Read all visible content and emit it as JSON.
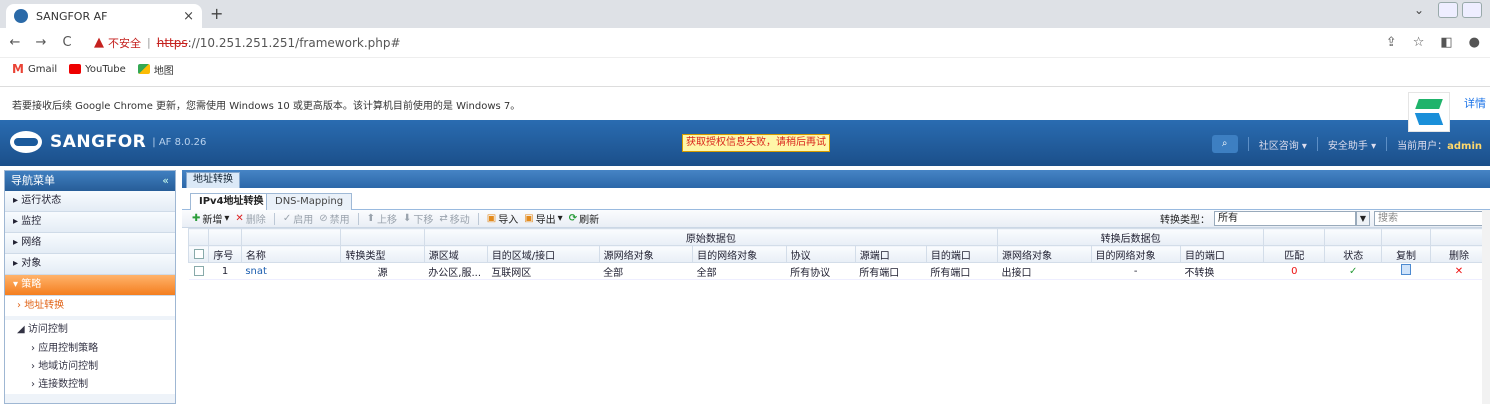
{
  "browser": {
    "tab_title": "SANGFOR AF",
    "tab_close": "×",
    "new_tab": "+",
    "insecure_label": "不安全",
    "url_scheme": "https",
    "url_rest": "://10.251.251.251/framework.php#",
    "bookmarks": [
      {
        "label": "Gmail",
        "icon": "gmail-icon"
      },
      {
        "label": "YouTube",
        "icon": "youtube-icon"
      },
      {
        "label": "地图",
        "icon": "maps-icon"
      }
    ]
  },
  "infobar": {
    "message": "若要接收后续 Google Chrome 更新，您需使用 Windows 10 或更高版本。该计算机目前使用的是 Windows 7。",
    "detail_link": "详情"
  },
  "header": {
    "brand": "SANGFOR",
    "version": "AF 8.0.26",
    "alert": "获取授权信息失败，请稍后再试",
    "community": "社区咨询 ▾",
    "security_assistant": "安全助手 ▾",
    "current_user_label": "当前用户：",
    "current_user": "admin"
  },
  "sidebar": {
    "title": "导航菜单",
    "collapse": "«",
    "items": [
      "运行状态",
      "监控",
      "网络",
      "对象"
    ],
    "open_item": "策略",
    "sub_active": "地址转换",
    "group": "访问控制",
    "group_items": [
      "应用控制策略",
      "地域访问控制",
      "连接数控制"
    ]
  },
  "main": {
    "tab": "地址转换",
    "subtabs": {
      "active": "IPv4地址转换",
      "other": "DNS-Mapping"
    },
    "toolbar": {
      "add": "新增",
      "delete": "删除",
      "enable": "启用",
      "disable": "禁用",
      "up": "上移",
      "down": "下移",
      "move": "移动",
      "import": "导入",
      "export": "导出",
      "refresh": "刷新"
    },
    "filter": {
      "label": "转换类型：",
      "value": "所有",
      "search_placeholder": "搜索"
    },
    "table": {
      "group_original": "原始数据包",
      "group_translated": "转换后数据包",
      "headers": [
        "序号",
        "名称",
        "转换类型",
        "源区域",
        "目的区域/接口",
        "源网络对象",
        "目的网络对象",
        "协议",
        "源端口",
        "目的端口",
        "源网络对象",
        "目的网络对象",
        "目的端口",
        "匹配",
        "状态",
        "复制",
        "删除"
      ],
      "rows": [
        {
          "index": "1",
          "name": "snat",
          "type": "源",
          "src_zone": "办公区,服...",
          "dst_zone": "互联网区",
          "src_net": "全部",
          "dst_net": "全部",
          "protocol": "所有协议",
          "src_port": "所有端口",
          "dst_port": "所有端口",
          "t_src_net": "出接口",
          "t_dst_net": "-",
          "t_dst_port": "不转换",
          "match": "0",
          "status_icon": "check-icon",
          "copy_icon": "copy-icon",
          "delete_icon": "delete-icon"
        }
      ]
    }
  }
}
